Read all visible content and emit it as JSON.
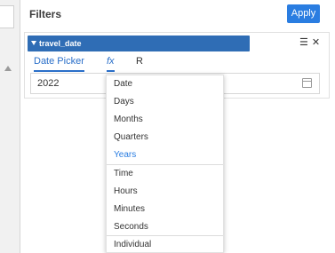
{
  "filters": {
    "title": "Filters",
    "apply_label": "Apply"
  },
  "card": {
    "field_name": "travel_date",
    "icons": [
      "list-icon",
      "close-icon"
    ],
    "tabs": [
      {
        "label": "Date Picker",
        "active": true
      },
      {
        "label": "fx",
        "active": true
      },
      {
        "label": "R",
        "active": false
      }
    ],
    "date_value": "2022"
  },
  "dropdown": {
    "items": [
      {
        "label": "Date",
        "selected": false
      },
      {
        "label": "Days",
        "selected": false
      },
      {
        "label": "Months",
        "selected": false
      },
      {
        "label": "Quarters",
        "selected": false
      },
      {
        "label": "Years",
        "selected": true
      },
      {
        "label": "Time",
        "selected": false
      },
      {
        "label": "Hours",
        "selected": false
      },
      {
        "label": "Minutes",
        "selected": false
      },
      {
        "label": "Seconds",
        "selected": false
      },
      {
        "label": "Individual",
        "selected": false
      }
    ]
  },
  "colors": {
    "accent": "#2a7de1",
    "field_bar": "#2f6db5"
  }
}
